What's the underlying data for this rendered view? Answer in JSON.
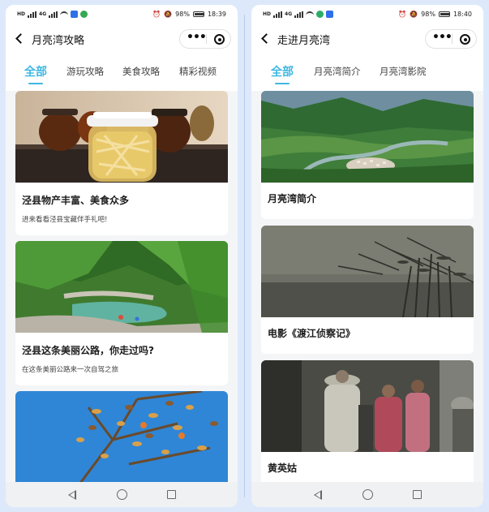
{
  "left_screen": {
    "status": {
      "network_left": "HD",
      "network_right": "4G",
      "battery": "98%",
      "time": "18:39",
      "app_icons": [
        {
          "name": "app-notification-icon",
          "color": "#2f6fe8"
        },
        {
          "name": "app-notification-icon-2",
          "color": "#35a852"
        }
      ]
    },
    "title": "月亮湾攻略",
    "tabs": [
      {
        "label": "全部",
        "active": true
      },
      {
        "label": "游玩攻略",
        "active": false
      },
      {
        "label": "美食攻略",
        "active": false
      },
      {
        "label": "精彩视频",
        "active": false
      }
    ],
    "cards": [
      {
        "title": "泾县物产丰富、美食众多",
        "subtitle": "进来看看泾县宝藏伴手礼吧!",
        "image": "jars-of-local-food-photo"
      },
      {
        "title": "泾县这条美丽公路，你走过吗?",
        "subtitle": "在这条美丽公路来一次自驾之旅",
        "image": "mountain-river-road-photo"
      },
      {
        "title": "",
        "subtitle": "",
        "image": "persimmon-tree-photo"
      }
    ]
  },
  "right_screen": {
    "status": {
      "network_left": "HD",
      "network_right": "4G",
      "battery": "98%",
      "time": "18:40",
      "app_icons": [
        {
          "name": "app-wechat-icon",
          "color": "#2aae67"
        },
        {
          "name": "app-notification-icon",
          "color": "#2f6fe8"
        }
      ]
    },
    "title": "走进月亮湾",
    "tabs": [
      {
        "label": "全部",
        "active": true
      },
      {
        "label": "月亮湾简介",
        "active": false
      },
      {
        "label": "月亮湾影院",
        "active": false
      }
    ],
    "cards": [
      {
        "title": "月亮湾简介",
        "image": "aerial-moon-bay-photo"
      },
      {
        "title": "电影《渡江侦察记》",
        "image": "film-still-reeds-photo"
      },
      {
        "title": "黄英姑",
        "image": "film-still-street-photo"
      }
    ]
  },
  "colors": {
    "accent": "#3fb7e2",
    "page_background": "#dde9fb",
    "card_background": "#ffffff",
    "list_background": "#f4f5f7"
  }
}
